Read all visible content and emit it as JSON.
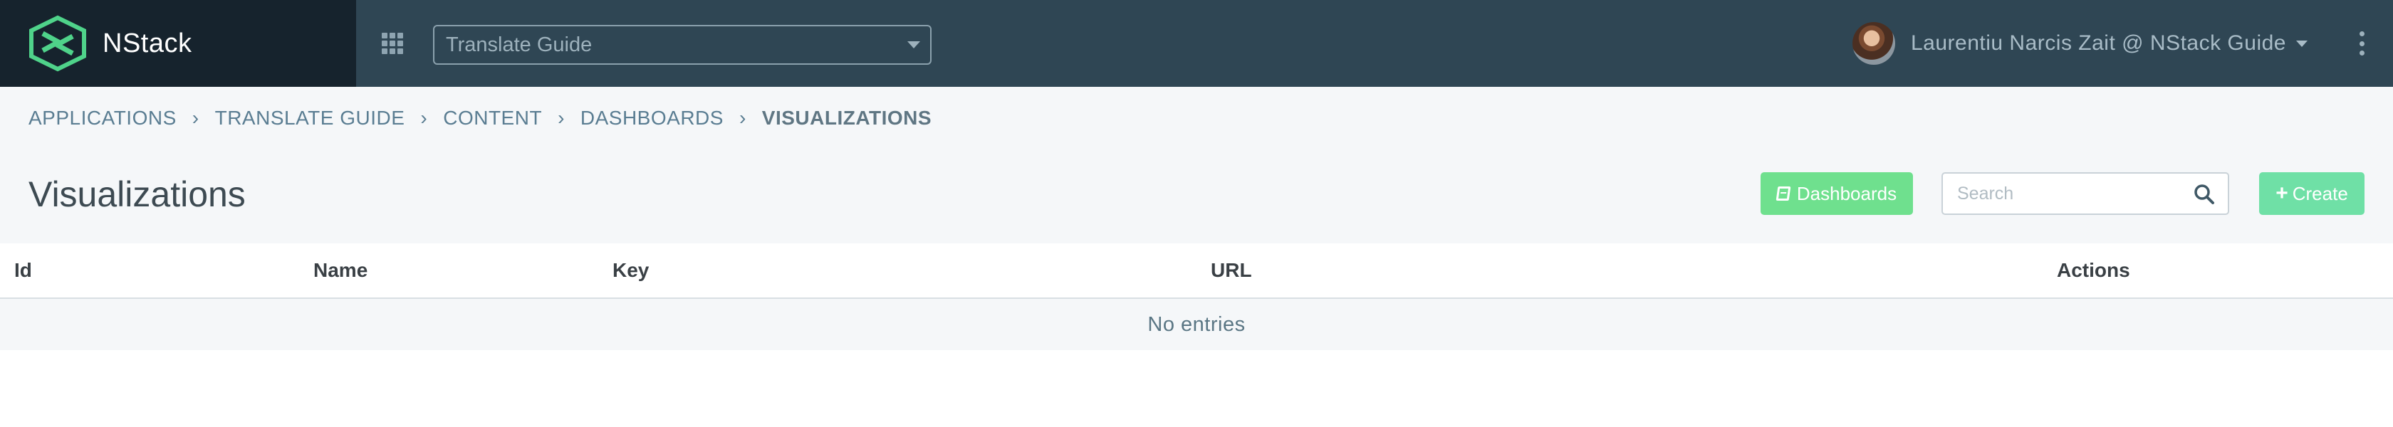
{
  "header": {
    "brand": "NStack",
    "app_select": {
      "value": "Translate Guide"
    },
    "user": {
      "name": "Laurentiu Narcis Zait @ NStack Guide"
    }
  },
  "breadcrumb": {
    "items": [
      {
        "label": "APPLICATIONS"
      },
      {
        "label": "TRANSLATE GUIDE"
      },
      {
        "label": "CONTENT"
      },
      {
        "label": "DASHBOARDS"
      },
      {
        "label": "VISUALIZATIONS",
        "active": true
      }
    ],
    "separator": "›"
  },
  "page": {
    "title": "Visualizations",
    "dashboards_button": "Dashboards",
    "search_placeholder": "Search",
    "create_button": "Create"
  },
  "table": {
    "columns": [
      "Id",
      "Name",
      "Key",
      "URL",
      "Actions"
    ],
    "empty_message": "No entries"
  },
  "colors": {
    "header_bg": "#2f4654",
    "brand_bg": "#16232d",
    "accent_green": "#6fe08e",
    "create_green": "#6fe0a6",
    "breadcrumb_link": "#5a7d92"
  },
  "icons": {
    "brand": "nstack-logo-icon",
    "apps": "grid-icon",
    "more": "vertical-dots-icon",
    "dashboards": "book-icon",
    "search": "search-icon",
    "create": "plus-icon"
  }
}
